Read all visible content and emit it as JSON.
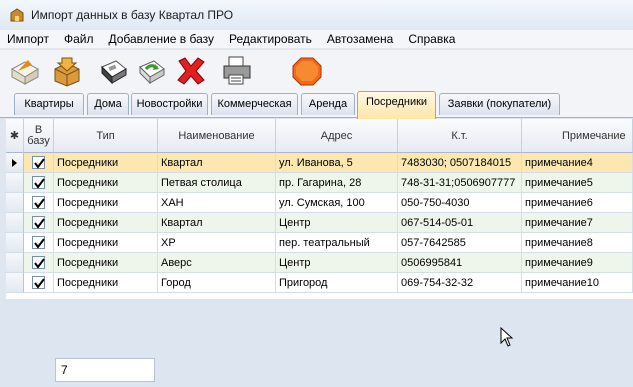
{
  "window": {
    "title": "Импорт данных в базу Квартал ПРО"
  },
  "menu": [
    "Импорт",
    "Файл",
    "Добавление в базу",
    "Редактировать",
    "Автозамена",
    "Справка"
  ],
  "toolbar_icons": [
    "open-box-icon",
    "import-box-icon",
    "save-icon",
    "refresh-icon",
    "delete-icon",
    "print-icon",
    "stop-icon"
  ],
  "tabs": [
    "Квартиры",
    "Дома",
    "Новостройки",
    "Коммерческая",
    "Аренда",
    "Посредники",
    "Заявки (покупатели)"
  ],
  "active_tab": "Посредники",
  "grid": {
    "star": "✱",
    "headers": {
      "in_db": "В базу",
      "type": "Тип",
      "name": "Наименование",
      "address": "Адрес",
      "phone": "К.т.",
      "note": "Примечание"
    },
    "rows": [
      {
        "checked": true,
        "type": "Посредники",
        "name": "Квартал",
        "address": "ул. Иванова, 5",
        "phone": "7483030; 0507184015",
        "note": "примечание4"
      },
      {
        "checked": true,
        "type": "Посредники",
        "name": "Петвая столица",
        "address": "пр. Гагарина, 28",
        "phone": "748-31-31;0506907777",
        "note": "примечание5"
      },
      {
        "checked": true,
        "type": "Посредники",
        "name": "ХАН",
        "address": "ул. Сумская, 100",
        "phone": "050-750-4030",
        "note": "примечание6"
      },
      {
        "checked": true,
        "type": "Посредники",
        "name": "Квартал",
        "address": "Центр",
        "phone": "067-514-05-01",
        "note": "примечание7"
      },
      {
        "checked": true,
        "type": "Посредники",
        "name": "ХР",
        "address": "пер. театральный",
        "phone": "057-7642585",
        "note": "примечание8"
      },
      {
        "checked": true,
        "type": "Посредники",
        "name": "Аверс",
        "address": "Центр",
        "phone": "0506995841",
        "note": "примечание9"
      },
      {
        "checked": true,
        "type": "Посредники",
        "name": "Город",
        "address": "Пригород",
        "phone": "069-754-32-32",
        "note": "примечание10"
      }
    ]
  },
  "record_count": "7",
  "colors": {
    "selected_row": "#fde7b0",
    "alt_row": "#eef5ea",
    "active_tab": "#ffe6a8"
  }
}
